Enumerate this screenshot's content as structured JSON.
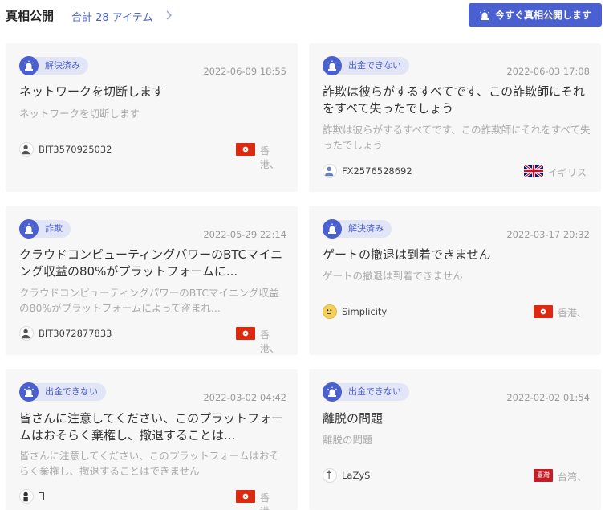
{
  "header": {
    "title": "真相公開",
    "count_text": "合計 28 アイテム",
    "button_label": "今すぐ真相公開します"
  },
  "colors": {
    "accent": "#4a5fd0",
    "badge_bg": "#e1e5f6",
    "card_bg": "#f7f7f7",
    "flag_red": "#de2910"
  },
  "cards": [
    {
      "status": "解決済み",
      "date": "2022-06-09 18:55",
      "title": "ネットワークを切断します",
      "desc": "ネットワークを切断します",
      "user": "BIT3570925032",
      "flag_icon": "hong-kong-flag-icon",
      "region": "香港、"
    },
    {
      "status": "出金できない",
      "date": "2022-06-03 17:08",
      "title": "詐欺は彼らがするすべてです、この詐欺師にそれをすべて失ったでしょう",
      "desc": "詐欺は彼らがするすべてです、この詐欺師にそれをすべて失ったでしょう",
      "user": "FX2576528692",
      "flag_icon": "uk-flag-icon",
      "region": "イギリス"
    },
    {
      "status": "詐欺",
      "date": "2022-05-29 22:14",
      "title": "クラウドコンピューティングパワーのBTCマイニング収益の80%がプラットフォームに...",
      "desc": "クラウドコンピューティングパワーのBTCマイニング収益の80%がプラットフォームによって盗まれ...",
      "user": "BIT3072877833",
      "flag_icon": "hong-kong-flag-icon",
      "region": "香港、"
    },
    {
      "status": "解決済み",
      "date": "2022-03-17 20:32",
      "title": "ゲートの撤退は到着できません",
      "desc": "ゲートの撤退は到着できません",
      "user": "Simplicity",
      "flag_icon": "hong-kong-flag-icon",
      "region": "香港、"
    },
    {
      "status": "出金できない",
      "date": "2022-03-02 04:42",
      "title": "皆さんに注意してください、このプラットフォームはおそらく棄権し、撤退することは...",
      "desc": "皆さんに注意してください、このプラットフォームはおそらく棄権し、撤退することはできません",
      "user": "",
      "flag_icon": "hong-kong-flag-icon",
      "region": "香港、"
    },
    {
      "status": "出金できない",
      "date": "2022-02-02 01:54",
      "title": "離脱の問題",
      "desc": "離脱の問題",
      "user": "LaZyS",
      "flag_icon": "taiwan-badge-icon",
      "flag_text": "臺灣",
      "region": "台湾、"
    }
  ]
}
